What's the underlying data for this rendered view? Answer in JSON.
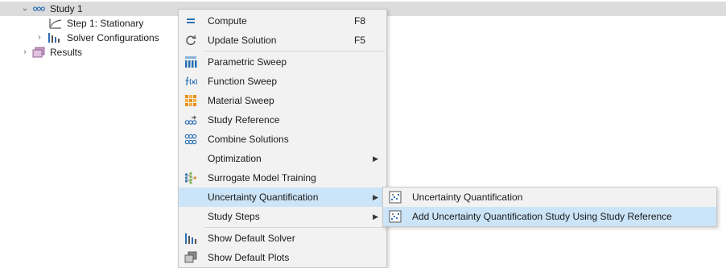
{
  "tree": {
    "study": "Study 1",
    "step": "Step 1: Stationary",
    "solver": "Solver Configurations",
    "results": "Results"
  },
  "menu": {
    "items": [
      {
        "label": "Compute",
        "shortcut": "F8",
        "icon": "compute-icon"
      },
      {
        "label": "Update Solution",
        "shortcut": "F5",
        "icon": "update-solution-icon"
      },
      {
        "label": "Parametric Sweep",
        "icon": "parametric-sweep-icon"
      },
      {
        "label": "Function Sweep",
        "icon": "function-sweep-icon"
      },
      {
        "label": "Material Sweep",
        "icon": "material-sweep-icon"
      },
      {
        "label": "Study Reference",
        "icon": "study-reference-icon"
      },
      {
        "label": "Combine Solutions",
        "icon": "combine-solutions-icon"
      },
      {
        "label": "Optimization",
        "submenu": true
      },
      {
        "label": "Surrogate Model Training",
        "icon": "surrogate-model-icon"
      },
      {
        "label": "Uncertainty Quantification",
        "submenu": true,
        "highlighted": true
      },
      {
        "label": "Study Steps",
        "submenu": true
      },
      {
        "label": "Show Default Solver",
        "icon": "solver-icon"
      },
      {
        "label": "Show Default Plots",
        "icon": "plots-icon"
      }
    ]
  },
  "submenu": {
    "items": [
      {
        "label": "Uncertainty Quantification",
        "icon": "uncertainty-quantification-icon"
      },
      {
        "label": "Add Uncertainty Quantification Study Using Study Reference",
        "icon": "uncertainty-quantification-icon",
        "highlighted": true
      }
    ]
  },
  "colors": {
    "highlight": "#cce4f7",
    "menu_bg": "#f2f2f2",
    "selected_row": "#dcdcdc",
    "icon_blue": "#2a6fb5",
    "icon_orange": "#e8901a"
  }
}
